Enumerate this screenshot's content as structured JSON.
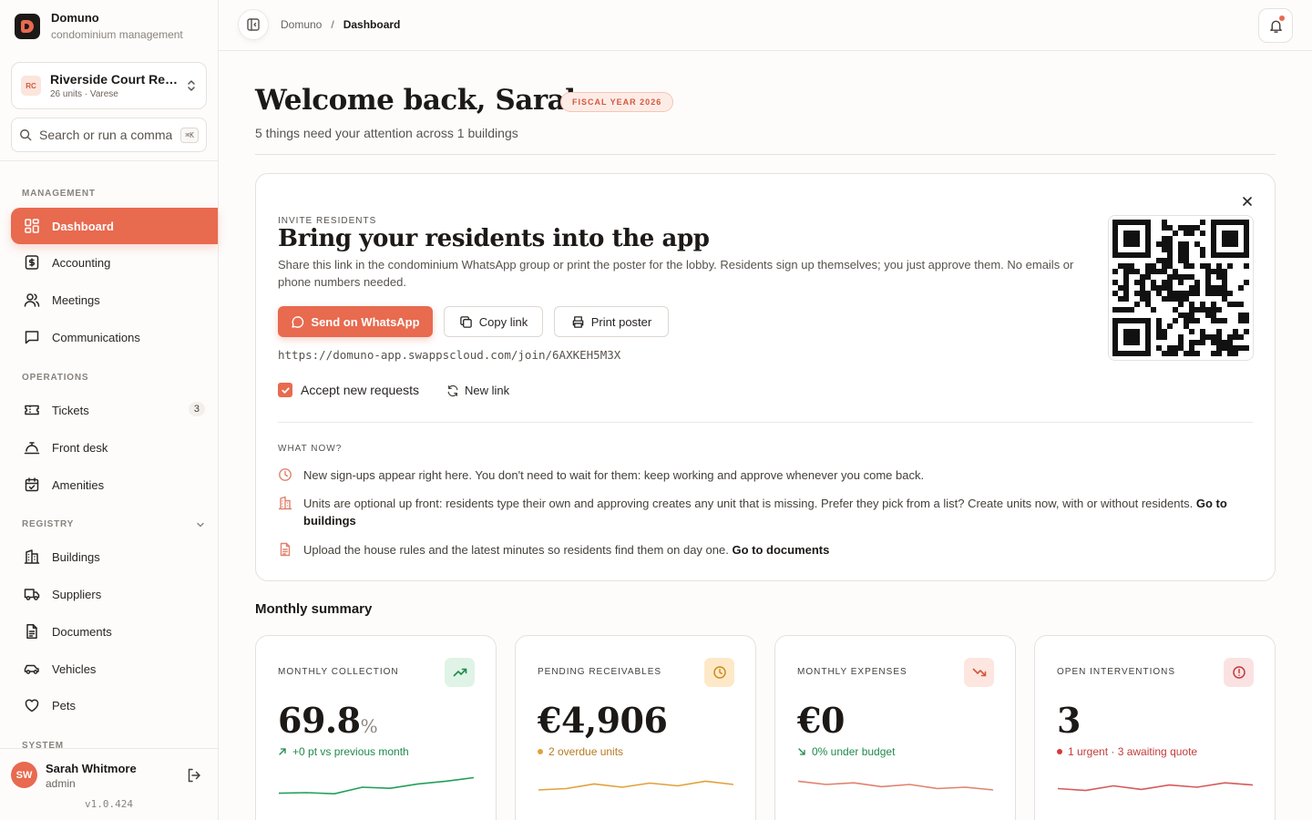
{
  "brand": {
    "name": "Domuno",
    "subtitle": "condominium management"
  },
  "building": {
    "initials": "RC",
    "name": "Riverside Court Residences",
    "meta": "26 units · Varese"
  },
  "search": {
    "placeholder": "Search or run a command",
    "shortcut": "⌘K"
  },
  "sidebar": {
    "sections": {
      "management": "MANAGEMENT",
      "operations": "OPERATIONS",
      "registry": "REGISTRY",
      "system": "SYSTEM"
    },
    "items": [
      {
        "label": "Dashboard",
        "icon": "dashboard-icon",
        "active": true
      },
      {
        "label": "Accounting",
        "icon": "dollar-icon"
      },
      {
        "label": "Meetings",
        "icon": "users-icon"
      },
      {
        "label": "Communications",
        "icon": "message-icon"
      },
      {
        "label": "Tickets",
        "icon": "ticket-icon",
        "count": "3"
      },
      {
        "label": "Front desk",
        "icon": "bell-desk-icon"
      },
      {
        "label": "Amenities",
        "icon": "calendar-icon"
      },
      {
        "label": "Buildings",
        "icon": "building-icon"
      },
      {
        "label": "Suppliers",
        "icon": "truck-icon"
      },
      {
        "label": "Documents",
        "icon": "document-icon"
      },
      {
        "label": "Vehicles",
        "icon": "car-icon"
      },
      {
        "label": "Pets",
        "icon": "heart-icon"
      }
    ]
  },
  "user": {
    "initials": "SW",
    "name": "Sarah Whitmore",
    "role": "admin",
    "version": "v1.0.424"
  },
  "breadcrumb": {
    "root": "Domuno",
    "separator": "/",
    "current": "Dashboard"
  },
  "header": {
    "welcome": "Welcome back, Sarah.",
    "fiscal_badge": "FISCAL YEAR 2026",
    "attention": "5 things need your attention across 1 buildings"
  },
  "invite": {
    "kicker": "INVITE RESIDENTS",
    "title": "Bring your residents into the app",
    "description": "Share this link in the condominium WhatsApp group or print the poster for the lobby. Residents sign up themselves; you just approve them. No emails or phone numbers needed.",
    "whatsapp_label": "Send on WhatsApp",
    "copy_label": "Copy link",
    "print_label": "Print poster",
    "url": "https://domuno-app.swappscloud.com/join/6AXKEH5M3X",
    "accept_label": "Accept new requests",
    "accept_checked": true,
    "new_link_label": "New link",
    "what_now_kicker": "WHAT NOW?",
    "tips": [
      {
        "text": "New sign-ups appear right here. You don't need to wait for them: keep working and approve whenever you come back.",
        "link": ""
      },
      {
        "text": "Units are optional up front: residents type their own and approving creates any unit that is missing. Prefer they pick from a list? Create units now, with or without residents. ",
        "link": "Go to buildings"
      },
      {
        "text": "Upload the house rules and the latest minutes so residents find them on day one. ",
        "link": "Go to documents"
      }
    ]
  },
  "summary": {
    "title": "Monthly summary",
    "cards": [
      {
        "label": "MONTHLY COLLECTION",
        "value": "69.8",
        "unit": "%",
        "sub": "+0 pt vs previous month",
        "sub_color": "#1f8a4c",
        "accent": "#22a05a",
        "icon_bg": "#dff3e6",
        "icon": "trend-up-icon",
        "spark": [
          0.28,
          0.3,
          0.26,
          0.5,
          0.46,
          0.62,
          0.72,
          0.85
        ]
      },
      {
        "label": "PENDING RECEIVABLES",
        "value": "€4,906",
        "unit": "",
        "sub": "2 overdue units",
        "sub_color": "#b7791f",
        "accent": "#e0a23a",
        "icon_bg": "#fde9c8",
        "icon": "clock-icon",
        "spark": [
          0.4,
          0.45,
          0.62,
          0.5,
          0.65,
          0.55,
          0.72,
          0.6
        ]
      },
      {
        "label": "MONTHLY EXPENSES",
        "value": "€0",
        "unit": "",
        "sub": "0% under budget",
        "sub_color": "#1f8a4c",
        "accent": "#e0826c",
        "icon_bg": "#fce6df",
        "icon": "trend-down-icon",
        "spark": [
          0.72,
          0.6,
          0.66,
          0.52,
          0.6,
          0.45,
          0.5,
          0.4
        ]
      },
      {
        "label": "OPEN INTERVENTIONS",
        "value": "3",
        "unit": "",
        "sub": "1 urgent · 3 awaiting quote",
        "sub_color": "#c23b3b",
        "accent": "#d65a5a",
        "icon_bg": "#fbe2e2",
        "icon": "alert-icon",
        "spark": [
          0.45,
          0.38,
          0.55,
          0.42,
          0.58,
          0.5,
          0.66,
          0.58
        ]
      }
    ]
  }
}
